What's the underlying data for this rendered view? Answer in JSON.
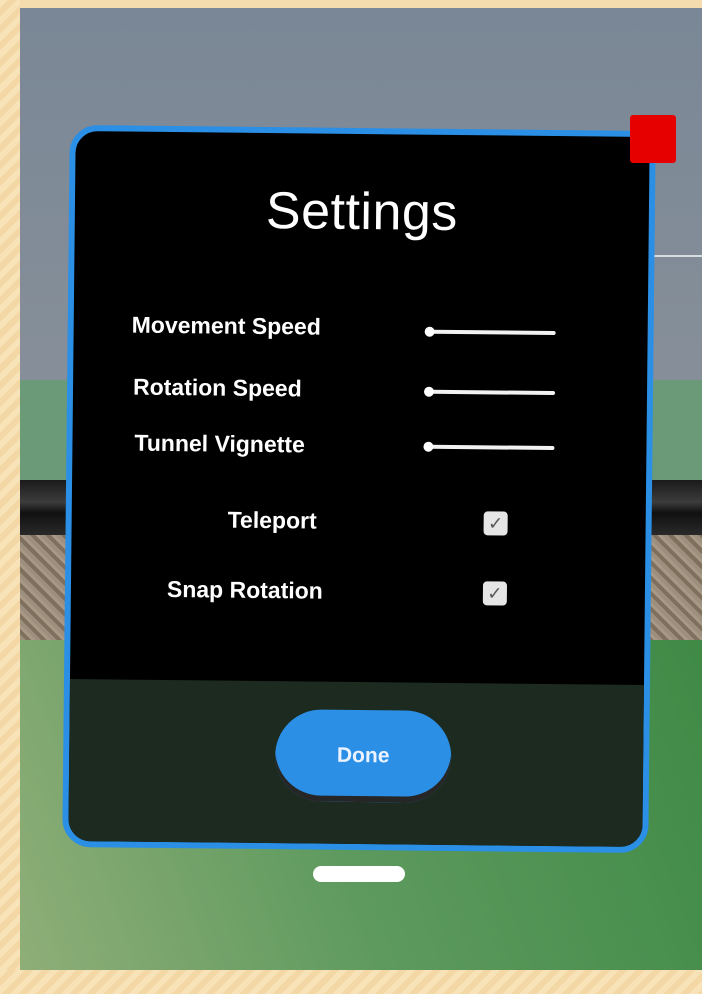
{
  "panel": {
    "title": "Settings",
    "accent_color": "#2b8fe6",
    "sliders": [
      {
        "label": "Movement Speed",
        "value": 0.0
      },
      {
        "label": "Rotation Speed",
        "value": 0.0
      },
      {
        "label": "Tunnel Vignette",
        "value": 0.0
      }
    ],
    "toggles": [
      {
        "label": "Teleport",
        "checked": true,
        "icon": "checkmark-icon"
      },
      {
        "label": "Snap Rotation",
        "checked": true,
        "icon": "checkmark-icon"
      }
    ],
    "done_label": "Done"
  },
  "window_controls": {
    "close_color": "#e60000",
    "handle_icon": "grab-handle"
  }
}
